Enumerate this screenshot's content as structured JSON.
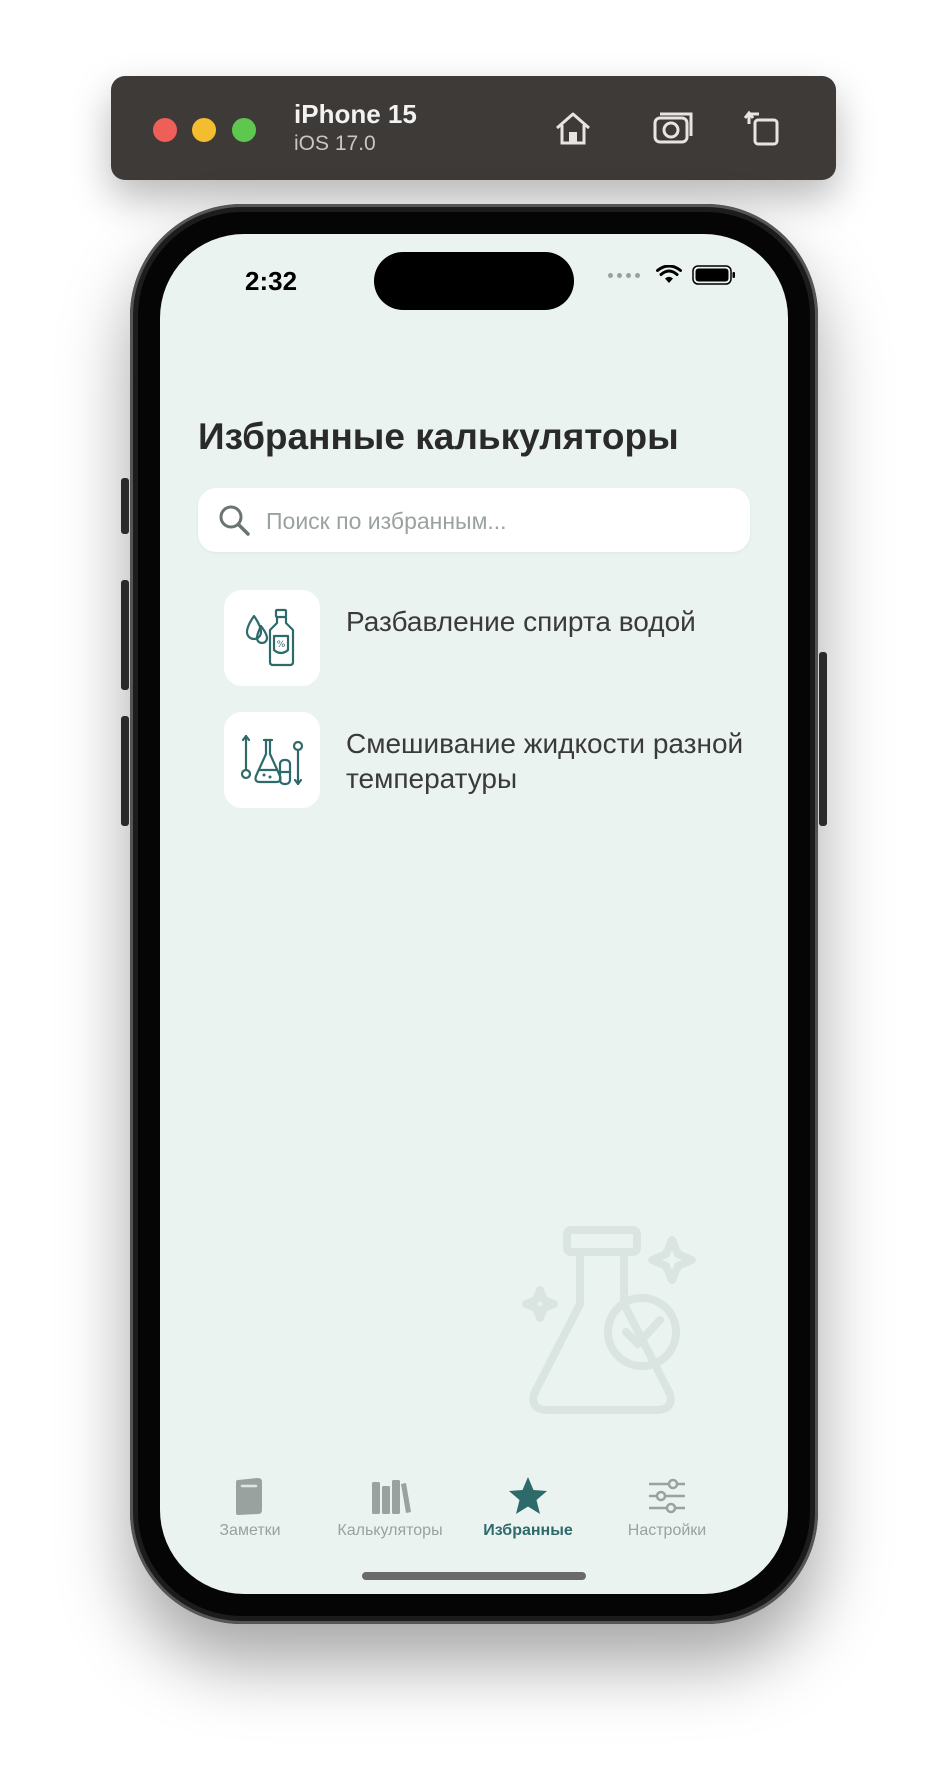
{
  "simulator": {
    "device_name": "iPhone 15",
    "os_version": "iOS 17.0"
  },
  "status_bar": {
    "time": "2:32"
  },
  "page": {
    "title": "Избранные калькуляторы",
    "search_placeholder": "Поиск по избранным..."
  },
  "favorites": [
    {
      "label": "Разбавление спирта водой",
      "icon": "alcohol-bottle-percent-icon"
    },
    {
      "label": "Смешивание жидкости разной температуры",
      "icon": "flasks-thermometer-icon"
    }
  ],
  "tabbar": {
    "tabs": [
      {
        "label": "Заметки",
        "icon": "notebook-icon",
        "active": false
      },
      {
        "label": "Калькуляторы",
        "icon": "books-icon",
        "active": false
      },
      {
        "label": "Избранные",
        "icon": "star-icon",
        "active": true
      },
      {
        "label": "Настройки",
        "icon": "sliders-icon",
        "active": false
      }
    ]
  },
  "colors": {
    "accent": "#2f6a6a",
    "background": "#eaf3ef",
    "inactive": "#9aa2a0"
  }
}
